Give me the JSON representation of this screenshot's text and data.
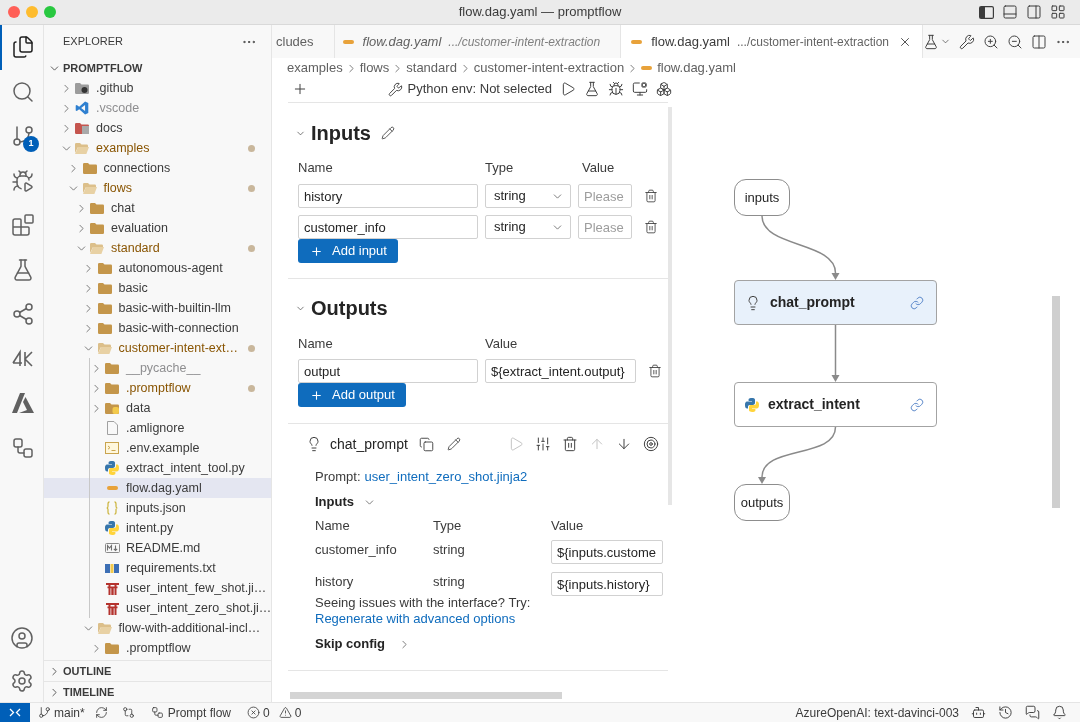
{
  "window": {
    "title": "flow.dag.yaml — promptflow"
  },
  "activity_bar": {
    "items": [
      {
        "selected": true
      },
      {
        "selected": false
      },
      {
        "selected": false,
        "badge": "1"
      },
      {
        "selected": false
      },
      {
        "selected": false
      },
      {
        "selected": false
      },
      {
        "selected": false
      },
      {
        "selected": false
      },
      {
        "selected": false
      },
      {
        "selected": false
      }
    ]
  },
  "sidebar": {
    "title": "EXPLORER",
    "section": {
      "label": "PROMPTFLOW",
      "expanded": true,
      "tree": [
        {
          "label": ".github",
          "kind": "github",
          "expanded": false,
          "selected": false,
          "modified": false,
          "ignored": false
        },
        {
          "label": ".vscode",
          "kind": "vscode",
          "expanded": false,
          "selected": false,
          "modified": false,
          "ignored": true
        },
        {
          "label": "docs",
          "kind": "docs",
          "expanded": false,
          "selected": false,
          "modified": false,
          "ignored": false
        },
        {
          "label": "examples",
          "kind": "folder",
          "expanded": true,
          "selected": false,
          "modified": true,
          "ignored": false,
          "children": [
            {
              "label": "connections",
              "kind": "folder",
              "expanded": false,
              "selected": false,
              "modified": false,
              "ignored": false
            },
            {
              "label": "flows",
              "kind": "folder",
              "expanded": true,
              "selected": false,
              "modified": true,
              "ignored": false,
              "children": [
                {
                  "label": "chat",
                  "kind": "folder",
                  "expanded": false,
                  "selected": false,
                  "modified": false,
                  "ignored": false
                },
                {
                  "label": "evaluation",
                  "kind": "folder",
                  "expanded": false,
                  "selected": false,
                  "modified": false,
                  "ignored": false
                },
                {
                  "label": "standard",
                  "kind": "folder",
                  "expanded": true,
                  "selected": false,
                  "modified": true,
                  "ignored": false,
                  "children": [
                    {
                      "label": "autonomous-agent",
                      "kind": "folder",
                      "expanded": false,
                      "selected": false,
                      "modified": false,
                      "ignored": false
                    },
                    {
                      "label": "basic",
                      "kind": "folder",
                      "expanded": false,
                      "selected": false,
                      "modified": false,
                      "ignored": false
                    },
                    {
                      "label": "basic-with-builtin-llm",
                      "kind": "folder",
                      "expanded": false,
                      "selected": false,
                      "modified": false,
                      "ignored": false
                    },
                    {
                      "label": "basic-with-connection",
                      "kind": "folder",
                      "expanded": false,
                      "selected": false,
                      "modified": false,
                      "ignored": false
                    },
                    {
                      "label": "customer-intent-ext…",
                      "kind": "folder",
                      "expanded": true,
                      "selected": false,
                      "modified": true,
                      "ignored": false,
                      "children": [
                        {
                          "label": "__pycache__",
                          "kind": "folder",
                          "expanded": false,
                          "selected": false,
                          "modified": false,
                          "ignored": true
                        },
                        {
                          "label": ".promptflow",
                          "kind": "folder",
                          "expanded": false,
                          "selected": false,
                          "modified": true,
                          "ignored": false
                        },
                        {
                          "label": "data",
                          "kind": "data",
                          "expanded": false,
                          "selected": false,
                          "modified": false,
                          "ignored": false
                        },
                        {
                          "label": ".amlignore",
                          "kind": "file",
                          "selected": false,
                          "modified": false,
                          "ignored": false
                        },
                        {
                          "label": ".env.example",
                          "kind": "env",
                          "selected": false,
                          "modified": false,
                          "ignored": false
                        },
                        {
                          "label": "extract_intent_tool.py",
                          "kind": "python",
                          "selected": false,
                          "modified": false,
                          "ignored": false
                        },
                        {
                          "label": "flow.dag.yaml",
                          "kind": "yaml",
                          "selected": true,
                          "modified": false,
                          "ignored": false
                        },
                        {
                          "label": "inputs.json",
                          "kind": "json",
                          "selected": false,
                          "modified": false,
                          "ignored": false
                        },
                        {
                          "label": "intent.py",
                          "kind": "python",
                          "selected": false,
                          "modified": false,
                          "ignored": false
                        },
                        {
                          "label": "README.md",
                          "kind": "markdown",
                          "selected": false,
                          "modified": false,
                          "ignored": false
                        },
                        {
                          "label": "requirements.txt",
                          "kind": "pip",
                          "selected": false,
                          "modified": false,
                          "ignored": false
                        },
                        {
                          "label": "user_intent_few_shot.ji…",
                          "kind": "jinja",
                          "selected": false,
                          "modified": false,
                          "ignored": false
                        },
                        {
                          "label": "user_intent_zero_shot.ji…",
                          "kind": "jinja",
                          "selected": false,
                          "modified": false,
                          "ignored": false
                        }
                      ]
                    },
                    {
                      "label": "flow-with-additional-incl…",
                      "kind": "folder",
                      "expanded": true,
                      "selected": false,
                      "modified": false,
                      "ignored": false,
                      "children": [
                        {
                          "label": ".promptflow",
                          "kind": "folder",
                          "expanded": false,
                          "selected": false,
                          "modified": false,
                          "ignored": false
                        }
                      ]
                    }
                  ]
                }
              ]
            }
          ]
        }
      ]
    },
    "panels": [
      {
        "label": "OUTLINE",
        "expanded": false
      },
      {
        "label": "TIMELINE",
        "expanded": false
      }
    ]
  },
  "tabs": [
    {
      "label": "cludes",
      "selected": false,
      "preview": false
    },
    {
      "label": "flow.dag.yaml",
      "description": ".../customer-intent-extraction",
      "kind": "yaml",
      "selected": false,
      "preview": true
    },
    {
      "label": "flow.dag.yaml",
      "description": ".../customer-intent-extraction",
      "kind": "yaml",
      "selected": true,
      "preview": false
    }
  ],
  "breadcrumb": [
    {
      "label": "examples"
    },
    {
      "label": "flows"
    },
    {
      "label": "standard"
    },
    {
      "label": "customer-intent-extraction"
    },
    {
      "label": "flow.dag.yaml",
      "kind": "yaml"
    }
  ],
  "flow_toolbar": {
    "python_env": "Python env: Not selected"
  },
  "inputs_section": {
    "title": "Inputs",
    "expanded": true,
    "columns": [
      "Name",
      "Type",
      "Value"
    ],
    "rows": [
      {
        "name": "history",
        "type": "string",
        "placeholder": "Please"
      },
      {
        "name": "customer_info",
        "type": "string",
        "placeholder": "Please"
      }
    ],
    "add_button": "Add input"
  },
  "outputs_section": {
    "title": "Outputs",
    "expanded": true,
    "columns": [
      "Name",
      "Value"
    ],
    "rows": [
      {
        "name": "output",
        "value": "${extract_intent.output}"
      }
    ],
    "add_button": "Add output"
  },
  "node": {
    "name": "chat_prompt",
    "kind": "llm",
    "actions": [
      {
        "disabled": true
      },
      {
        "disabled": false
      },
      {
        "disabled": false
      },
      {
        "disabled": true
      },
      {
        "disabled": false
      },
      {
        "disabled": false
      }
    ],
    "prompt_label": "Prompt:",
    "prompt_file": "user_intent_zero_shot.jinja2",
    "inputs_title": "Inputs",
    "inputs_expanded": true,
    "columns": [
      "Name",
      "Type",
      "Value"
    ],
    "inputs": [
      {
        "name": "customer_info",
        "type": "string",
        "value": "${inputs.custome"
      },
      {
        "name": "history",
        "type": "string",
        "value": "${inputs.history}"
      }
    ],
    "hint": "Seeing issues with the interface? Try:",
    "hint_link": "Regenerate with advanced options",
    "skip_config": {
      "label": "Skip config",
      "expanded": false
    }
  },
  "graph": {
    "nodes": [
      {
        "label": "inputs",
        "kind": "io",
        "selected": false
      },
      {
        "label": "chat_prompt",
        "kind": "llm",
        "selected": true
      },
      {
        "label": "extract_intent",
        "kind": "python",
        "selected": false
      },
      {
        "label": "outputs",
        "kind": "io",
        "selected": false
      }
    ]
  },
  "status_bar": {
    "branch": "main*",
    "flow_label": "Prompt flow",
    "errors": "0",
    "warnings": "0",
    "model": "AzureOpenAI: text-davinci-003"
  }
}
